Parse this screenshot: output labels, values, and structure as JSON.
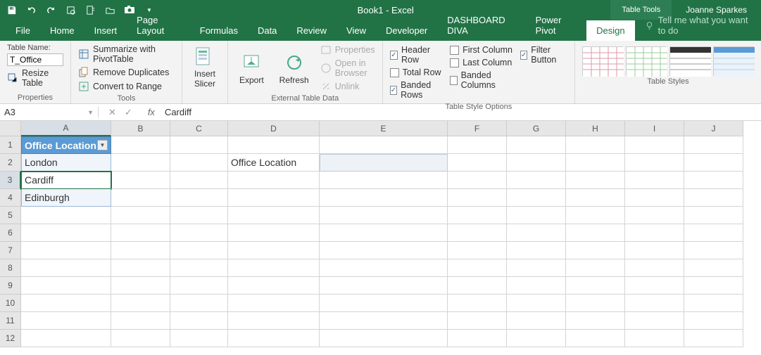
{
  "titlebar": {
    "title": "Book1  -  Excel",
    "tools_label": "Table Tools",
    "user": "Joanne Sparkes"
  },
  "tabs": {
    "file": "File",
    "home": "Home",
    "insert": "Insert",
    "pagelayout": "Page Layout",
    "formulas": "Formulas",
    "data": "Data",
    "review": "Review",
    "view": "View",
    "developer": "Developer",
    "dashboard": "DASHBOARD DIVA",
    "powerpivot": "Power Pivot",
    "design": "Design",
    "tellme": "Tell me what you want to do"
  },
  "ribbon": {
    "properties": {
      "label": "Properties",
      "tablename_label": "Table Name:",
      "tablename_value": "T_Office",
      "resize": "Resize Table"
    },
    "tools": {
      "label": "Tools",
      "pivot": "Summarize with PivotTable",
      "dupes": "Remove Duplicates",
      "convert": "Convert to Range"
    },
    "slicer": {
      "label": "Insert\nSlicer"
    },
    "external": {
      "label": "External Table Data",
      "export": "Export",
      "refresh": "Refresh",
      "props": "Properties",
      "browser": "Open in Browser",
      "unlink": "Unlink"
    },
    "styleopts": {
      "label": "Table Style Options",
      "header": "Header Row",
      "total": "Total Row",
      "banded_r": "Banded Rows",
      "first": "First Column",
      "last": "Last Column",
      "banded_c": "Banded Columns",
      "filter": "Filter Button"
    },
    "styles": {
      "label": "Table Styles"
    }
  },
  "formula_bar": {
    "namebox": "A3",
    "formula": "Cardiff"
  },
  "grid": {
    "col_headers": [
      "A",
      "B",
      "C",
      "D",
      "E",
      "F",
      "G",
      "H",
      "I",
      "J"
    ],
    "row_headers": [
      "1",
      "2",
      "3",
      "4",
      "5",
      "6",
      "7",
      "8",
      "9",
      "10",
      "11",
      "12"
    ],
    "table_header": "Office Location",
    "table_rows": [
      "London",
      "Cardiff",
      "Edinburgh"
    ],
    "d2": "Office Location",
    "active_cell": "A3",
    "selected_range": "E2"
  }
}
